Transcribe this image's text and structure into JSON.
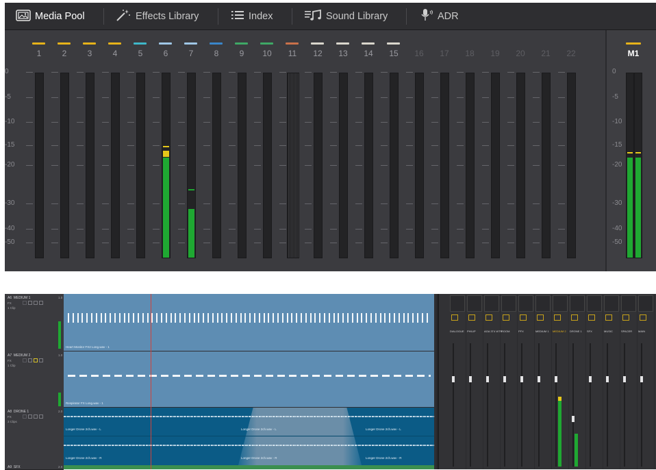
{
  "toolbar": {
    "items": [
      {
        "label": "Media Pool",
        "icon": "media-pool-icon",
        "active": true
      },
      {
        "label": "Effects Library",
        "icon": "effects-wand-icon",
        "active": false
      },
      {
        "label": "Index",
        "icon": "list-icon",
        "active": false
      },
      {
        "label": "Sound Library",
        "icon": "music-notes-icon",
        "active": false
      },
      {
        "label": "ADR",
        "icon": "microphone-icon",
        "active": false
      }
    ]
  },
  "meters": {
    "scale": [
      "0",
      "-5",
      "-10",
      "-15",
      "-20",
      "-30",
      "-40",
      "-50"
    ],
    "channels": [
      {
        "label": "1",
        "color": "#e6b21a",
        "active": true,
        "level": 0,
        "peak": null
      },
      {
        "label": "2",
        "color": "#e6b21a",
        "active": true,
        "level": 0,
        "peak": null
      },
      {
        "label": "3",
        "color": "#e6b21a",
        "active": true,
        "level": 0,
        "peak": null
      },
      {
        "label": "4",
        "color": "#e6b21a",
        "active": true,
        "level": 0,
        "peak": null
      },
      {
        "label": "5",
        "color": "#3fb8c9",
        "active": true,
        "level": 0,
        "peak": null
      },
      {
        "label": "6",
        "color": "#9fc6e6",
        "active": true,
        "level": -18,
        "peak": -15,
        "yellow_top": true
      },
      {
        "label": "7",
        "color": "#9fc6e6",
        "active": true,
        "level": -32,
        "peak": -26
      },
      {
        "label": "8",
        "color": "#3a86c9",
        "active": true,
        "level": 0,
        "peak": null
      },
      {
        "label": "9",
        "color": "#3fa866",
        "active": true,
        "level": 0,
        "peak": null
      },
      {
        "label": "10",
        "color": "#3fa866",
        "active": true,
        "level": 0,
        "peak": null
      },
      {
        "label": "11",
        "color": "#c9714a",
        "active": true,
        "level": 0,
        "peak": null,
        "striped": true
      },
      {
        "label": "12",
        "color": "#d9d6cc",
        "active": true,
        "level": 0,
        "peak": null
      },
      {
        "label": "13",
        "color": "#d9d6cc",
        "active": true,
        "level": 0,
        "peak": null
      },
      {
        "label": "14",
        "color": "#d9d6cc",
        "active": true,
        "level": 0,
        "peak": null
      },
      {
        "label": "15",
        "color": "#d9d6cc",
        "active": true,
        "level": 0,
        "peak": null
      },
      {
        "label": "16",
        "color": null,
        "active": false,
        "level": 0,
        "peak": null
      },
      {
        "label": "17",
        "color": null,
        "active": false,
        "level": 0,
        "peak": null
      },
      {
        "label": "18",
        "color": null,
        "active": false,
        "level": 0,
        "peak": null
      },
      {
        "label": "19",
        "color": null,
        "active": false,
        "level": 0,
        "peak": null
      },
      {
        "label": "20",
        "color": null,
        "active": false,
        "level": 0,
        "peak": null
      },
      {
        "label": "21",
        "color": null,
        "active": false,
        "level": 0,
        "peak": null
      },
      {
        "label": "22",
        "color": null,
        "active": false,
        "level": 0,
        "peak": null
      }
    ],
    "master": {
      "label": "M1",
      "color": "#e6b21a",
      "level": -18,
      "peak": -16.5
    }
  },
  "timeline": {
    "tracks": [
      {
        "id": "A6",
        "name": "MEDIUM 1",
        "gain": "1.0",
        "fx": "FX",
        "sub": "1 Clip"
      },
      {
        "id": "A7",
        "name": "MEDIUM 2",
        "gain": "1.0",
        "fx": "FX",
        "sub": "1 Clip"
      },
      {
        "id": "A8",
        "name": "DRONE 1",
        "gain": "2.0",
        "fx": "FX",
        "sub": "3 Clips"
      },
      {
        "id": "A9",
        "name": "SFX",
        "gain": "2.0",
        "fx": "",
        "sub": ""
      }
    ],
    "clips": [
      {
        "label": "Heart Monitor FX2 Long.wav - 1"
      },
      {
        "label": "Respirator FX Long.wav - 1"
      },
      {
        "label": "Longer Drone 2ch.wav - L"
      },
      {
        "label": "Longer Drone 2ch.wav - L"
      },
      {
        "label": "Longer Drone 2ch.wav - L"
      },
      {
        "label": "Longer Drone 2ch.wav - R"
      },
      {
        "label": "Longer Drone 2ch.wav - R"
      },
      {
        "label": "Longer Drone 2ch.wav - R"
      }
    ]
  },
  "mixer": {
    "channels": [
      "DIALOGUE",
      "PHILIP",
      "AGA 3T4 WTR",
      "ROOM",
      "PFX",
      "MEDIUM 1",
      "MEDIUM 2",
      "DRONE 1",
      "SFX",
      "MUSIC",
      "SPACER",
      "MAIN"
    ],
    "highlight": "MEDIUM 2",
    "colors": {
      "accent_yellow": "#e6b21a",
      "meter_green": "#1fa832"
    }
  }
}
